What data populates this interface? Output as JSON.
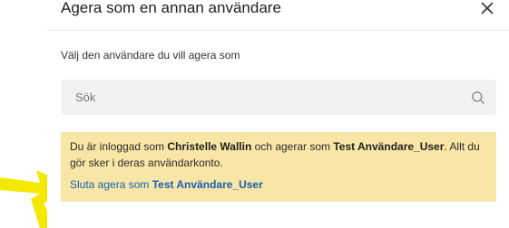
{
  "dialog": {
    "title": "Agera som en annan användare",
    "close_icon": "close-icon",
    "instruction": "Välj den användare du vill agera som"
  },
  "search": {
    "placeholder": "Sök",
    "value": "",
    "icon": "search-icon"
  },
  "banner": {
    "text_part1": "Du är inloggad som ",
    "logged_in_user": "Christelle Wallin",
    "text_part2": " och agerar som ",
    "acting_user": "Test Användare_User",
    "text_part3": ". Allt du gör sker i deras användarkonto.",
    "stop_prefix": "Sluta agera som ",
    "stop_user": "Test Användare_User",
    "background_color": "#f7e6a6",
    "link_color": "#1a5fb4"
  },
  "annotation": {
    "type": "yellow-arrow",
    "color": "#f5e800"
  }
}
